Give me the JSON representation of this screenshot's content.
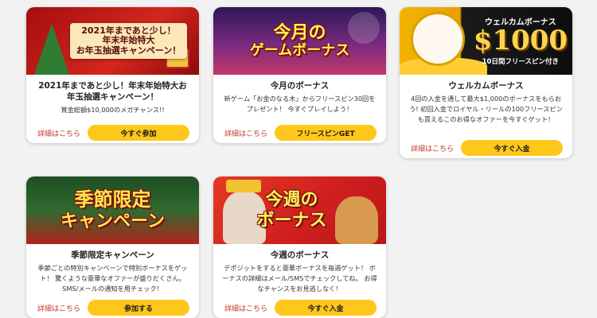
{
  "cards": [
    {
      "banner_lines": [
        "2021年まであと少し！",
        "年末年始特大",
        "お年玉抽選キャンペーン！"
      ],
      "title": "2021年まであと少し！年末年始特大お年玉抽選キャンペーン！",
      "desc": "賞金総額$10,000のメガチャンス!!",
      "link": "詳細はこちら",
      "button": "今すぐ参加"
    },
    {
      "banner_lines": [
        "今月の",
        "ゲームボーナス"
      ],
      "title": "今月のボーナス",
      "desc": "新ゲーム「お金のなる木」からフリースピン30回をプレゼント！ 今すぐプレイしよう！",
      "link": "詳細はこちら",
      "button": "フリースピンGET"
    },
    {
      "banner_title": "ウェルカムボーナス",
      "banner_amount": "$1000",
      "banner_sub": "10日間フリースピン付き",
      "title": "ウェルカムボーナス",
      "desc": "4回の入金を通して最大$1,000のボーナスをもらおう! 初回入金でロイヤル・リールの100フリースピンも貰えるこのお得なオファーを今すぐゲット！",
      "link": "詳細はこちら",
      "button": "今すぐ入金"
    },
    {
      "banner_lines": [
        "季節限定",
        "キャンペーン"
      ],
      "title": "季節限定キャンペーン",
      "desc": "季節ごとの特別キャンペーンで特別ボーナスをゲット！ 驚くような豪華なオファーが盛りだくさん。 SMS/メールの通知を用チェック！",
      "link": "詳細はこちら",
      "button": "参加する"
    },
    {
      "banner_lines": [
        "今週の",
        "ボーナス"
      ],
      "title": "今週のボーナス",
      "desc": "デポジットをすると豪華ボーナスを毎週ゲット！ ボーナスの詳細はメール/SMSでチェックしてね。 お得なチャンスをお見逃しなく！",
      "link": "詳細はこちら",
      "button": "今すぐ入金"
    }
  ],
  "colors": {
    "button_bg": "#ffc71a",
    "link": "#c0392b",
    "page_bg": "#f2f2f2"
  }
}
